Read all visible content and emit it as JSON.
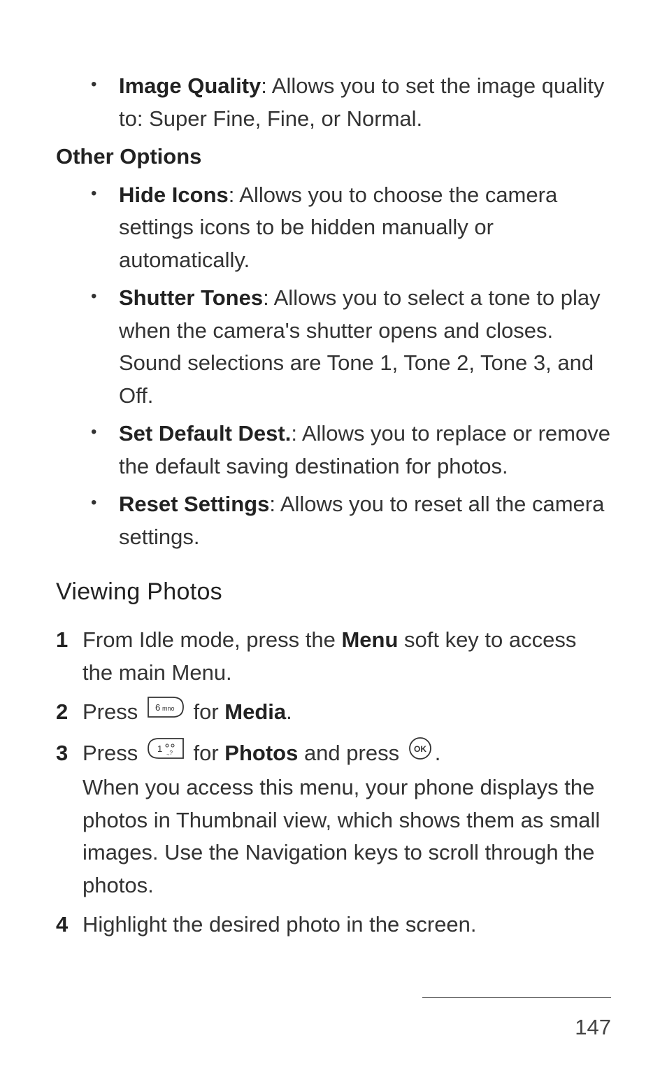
{
  "bullets_top": [
    {
      "label": "Image Quality",
      "desc": ": Allows you to set the image quality to: Super Fine, Fine, or Normal."
    }
  ],
  "other_options_heading": "Other Options",
  "bullets_other": [
    {
      "label": "Hide Icons",
      "desc": ": Allows you to choose the camera settings icons to be hidden manually or automatically."
    },
    {
      "label": "Shutter Tones",
      "desc": ": Allows you to select a tone to play when the camera's shutter opens and closes. Sound selections are Tone 1, Tone 2, Tone 3, and Off."
    },
    {
      "label": "Set Default Dest.",
      "desc": ": Allows you to replace or remove the default saving destination for photos."
    },
    {
      "label": "Reset Settings",
      "desc": ": Allows you to reset all the camera settings."
    }
  ],
  "viewing_heading": "Viewing Photos",
  "steps": {
    "s1_a": "From Idle mode, press the ",
    "s1_menu": "Menu",
    "s1_b": " soft key to access the main Menu.",
    "s2_a": "Press ",
    "s2_for": " for ",
    "s2_media": "Media",
    "s2_end": ".",
    "s3_a": "Press ",
    "s3_for": " for ",
    "s3_photos": "Photos",
    "s3_b": " and press ",
    "s3_end": ".",
    "s3_para": "When you access this menu, your phone displays the photos in Thumbnail view, which shows them as small images. Use the Navigation keys to scroll through the photos.",
    "s4": "Highlight the desired photo in the screen."
  },
  "page_number": "147"
}
